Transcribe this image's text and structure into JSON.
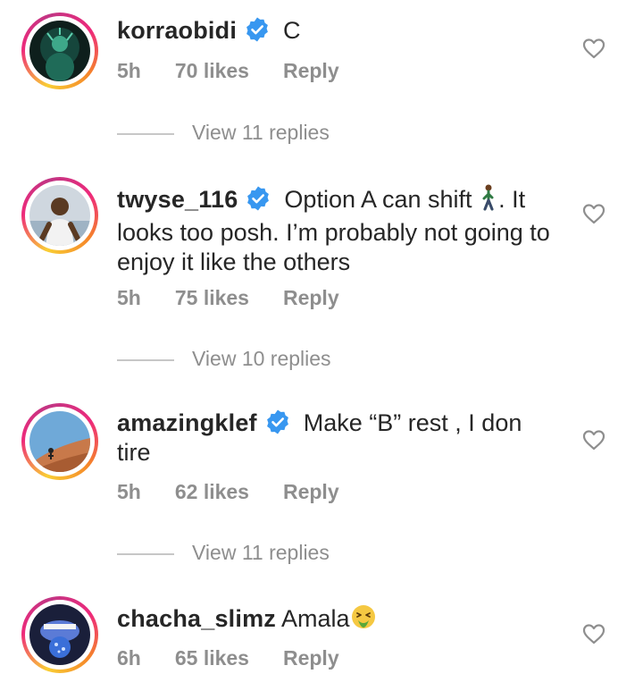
{
  "comments": [
    {
      "username": "korraobidi",
      "verified": true,
      "text": "C",
      "time": "5h",
      "likes": "70 likes",
      "reply": "Reply",
      "view_replies": "View 11 replies"
    },
    {
      "username": "twyse_116",
      "verified": true,
      "text_before_emoji": "Option A can shift ",
      "emoji": "person-walking",
      "text_after_emoji": ". It looks too posh. I’m probably not going to enjoy it like the others",
      "time": "5h",
      "likes": "75 likes",
      "reply": "Reply",
      "view_replies": "View 10 replies"
    },
    {
      "username": "amazingklef",
      "verified": true,
      "text": "Make “B” rest , I don tire",
      "time": "5h",
      "likes": "62 likes",
      "reply": "Reply",
      "view_replies": "View 11 replies"
    },
    {
      "username": "chacha_slimz",
      "verified": false,
      "text": "Amala",
      "emoji": "nauseated-face",
      "time": "6h",
      "likes": "65 likes",
      "reply": "Reply"
    }
  ],
  "colors": {
    "verified_blue": "#3897f0",
    "meta_gray": "#8e8e8e",
    "text_dark": "#262626"
  },
  "icons": {
    "like": "heart-outline-icon",
    "verified": "verified-badge-icon"
  }
}
